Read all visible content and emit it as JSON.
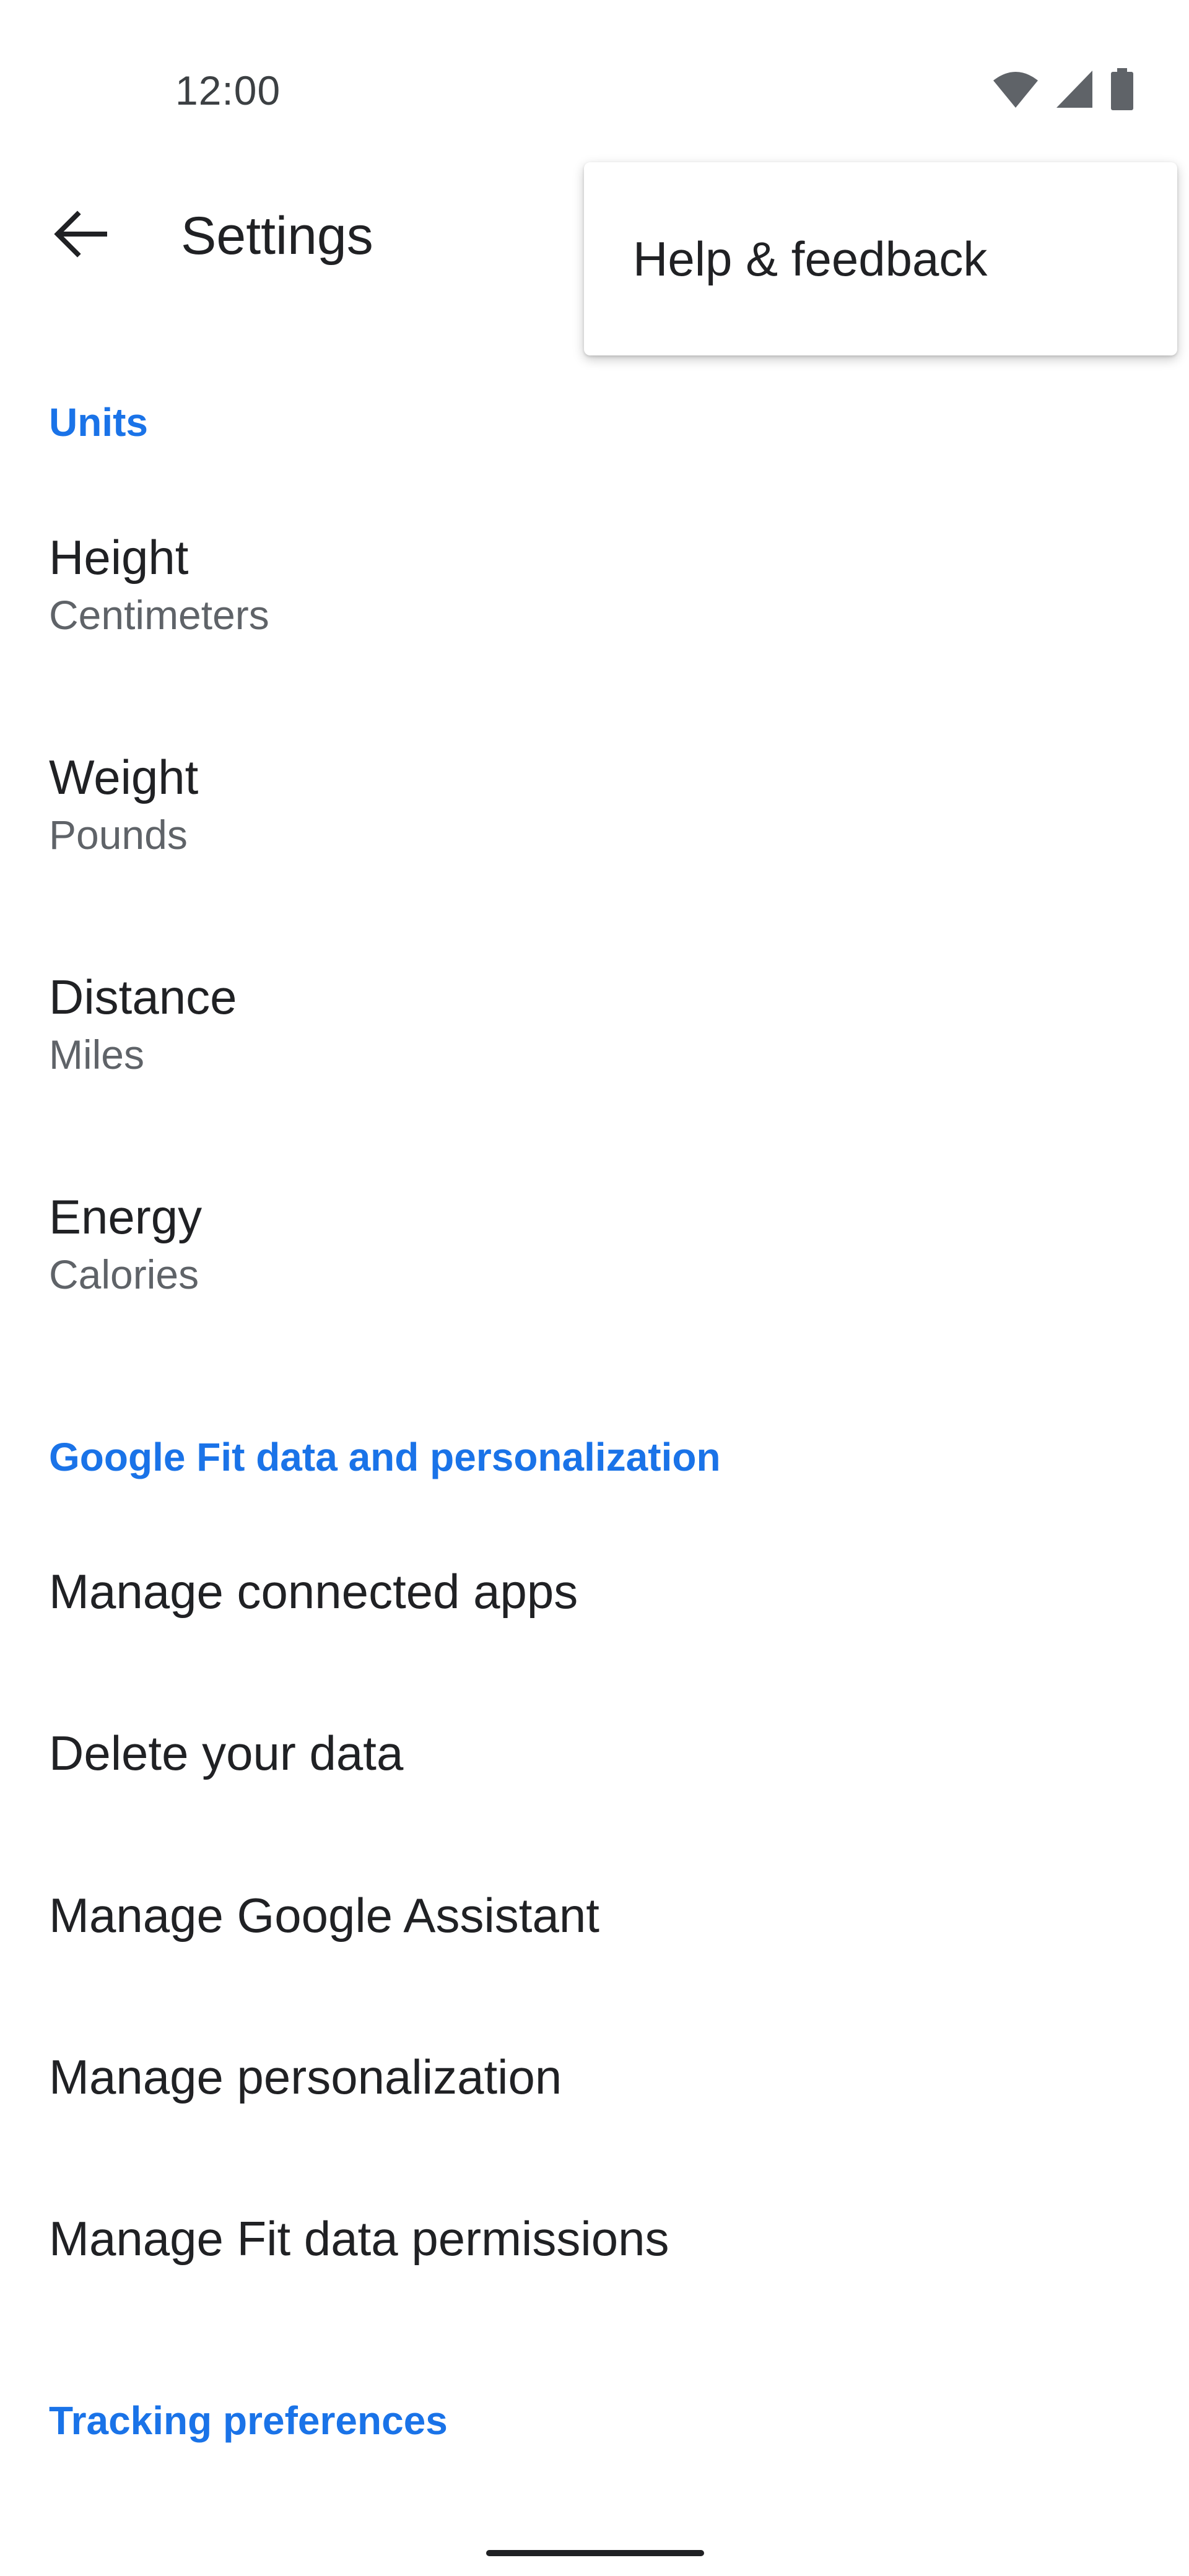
{
  "status_bar": {
    "time": "12:00",
    "icons": [
      "wifi-icon",
      "cellular-signal-icon",
      "battery-icon"
    ]
  },
  "app_bar": {
    "back_icon": "arrow-back-icon",
    "title": "Settings"
  },
  "popup_menu": {
    "items": [
      {
        "label": "Help & feedback"
      }
    ]
  },
  "sections": {
    "units": {
      "header": "Units",
      "items": [
        {
          "title": "Height",
          "value": "Centimeters"
        },
        {
          "title": "Weight",
          "value": "Pounds"
        },
        {
          "title": "Distance",
          "value": "Miles"
        },
        {
          "title": "Energy",
          "value": "Calories"
        }
      ]
    },
    "fit_data": {
      "header": "Google Fit data and personalization",
      "items": [
        {
          "title": "Manage connected apps"
        },
        {
          "title": "Delete your data"
        },
        {
          "title": "Manage Google Assistant"
        },
        {
          "title": "Manage personalization"
        },
        {
          "title": "Manage Fit data permissions"
        }
      ]
    },
    "tracking": {
      "header": "Tracking preferences"
    }
  },
  "colors": {
    "accent": "#1a73e8",
    "primary_text": "#202124",
    "secondary_text": "#5f6368",
    "background": "#ffffff"
  }
}
